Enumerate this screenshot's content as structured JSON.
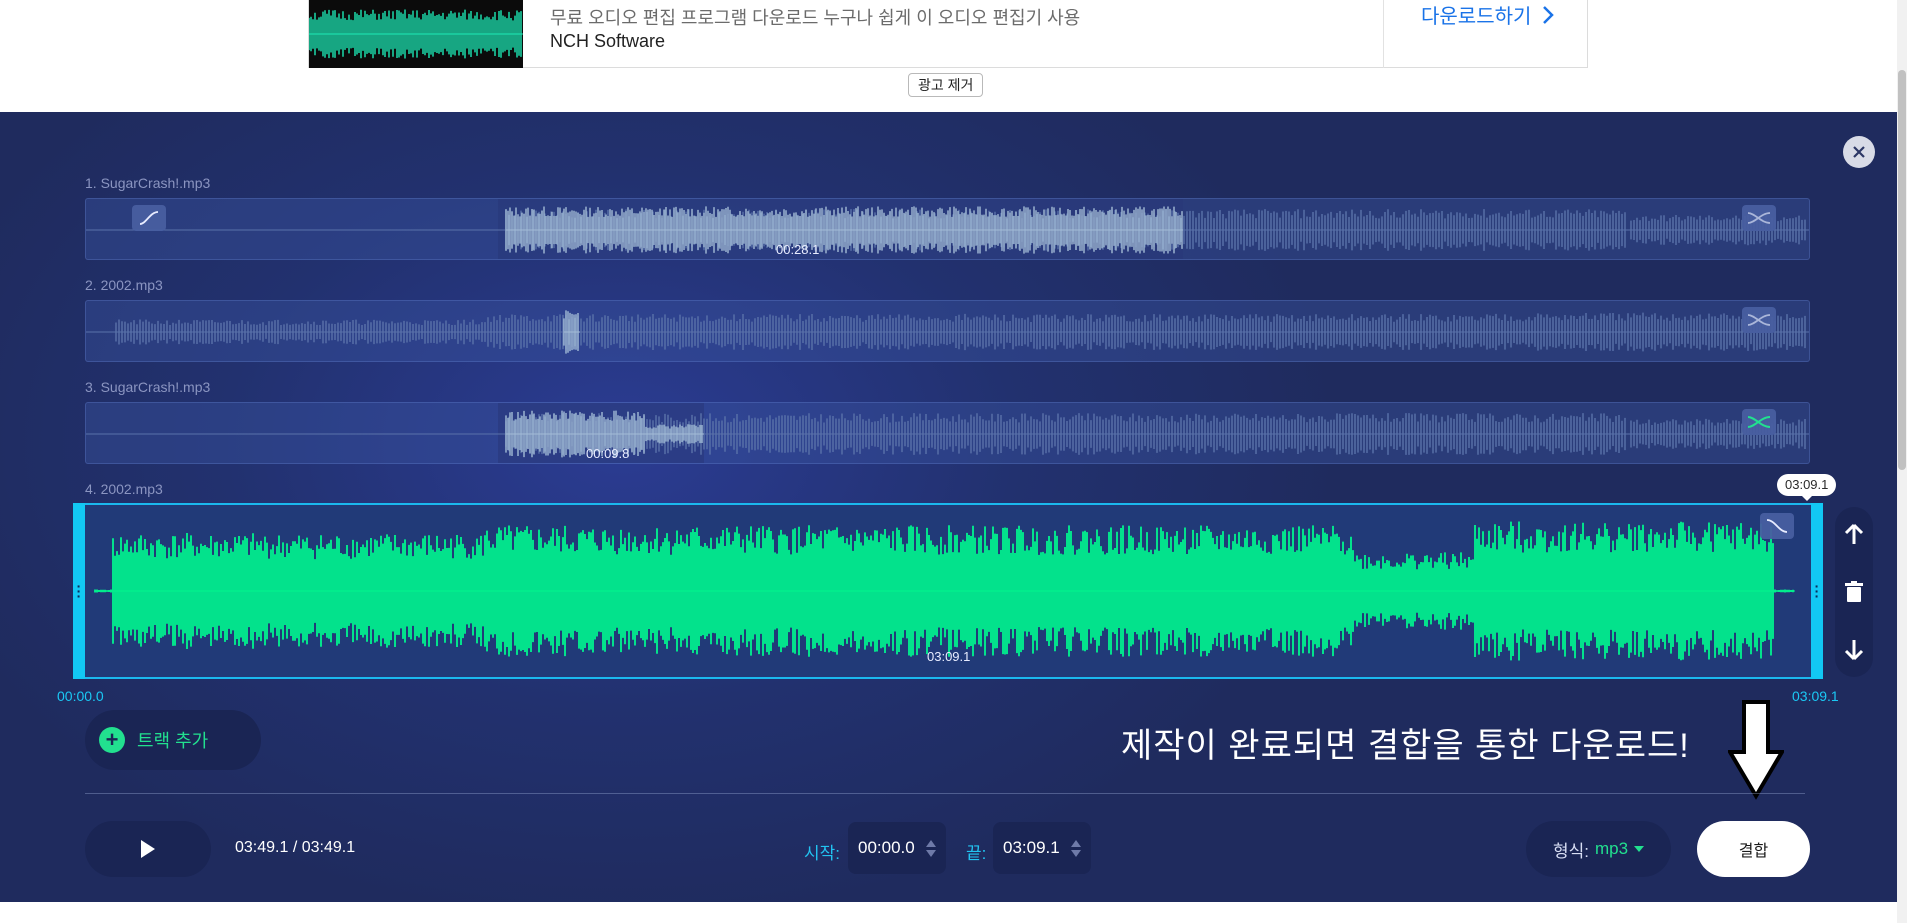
{
  "ad": {
    "description": "무료 오디오 편집 프로그램 다운로드 누구나 쉽게 이 오디오 편집기 사용",
    "brand": "NCH Software",
    "cta_label": "다운로드하기",
    "remove_label": "광고 제거"
  },
  "tracks": [
    {
      "label": "1. SugarCrash!.mp3",
      "selection_time": "00:28.1",
      "fade_icon": "fade-in-icon",
      "shuffle_icon": "crossfade-icon"
    },
    {
      "label": "2. 2002.mp3",
      "fade_icon": "",
      "shuffle_icon": "crossfade-icon"
    },
    {
      "label": "3. SugarCrash!.mp3",
      "selection_time": "00:09.8",
      "shuffle_icon": "crossfade-icon-active"
    },
    {
      "label": "4. 2002.mp3",
      "selection_time": "03:09.1",
      "tooltip": "03:09.1",
      "fade_icon": "fade-out-icon"
    }
  ],
  "range": {
    "start": "00:00.0",
    "end": "03:09.1"
  },
  "side_controls": [
    "move-up-icon",
    "trash-icon",
    "move-down-icon"
  ],
  "add_track_label": "트랙 추가",
  "annotation": "제작이 완료되면 결합을 통한 다운로드!",
  "player": {
    "time_display": "03:49.1 / 03:49.1"
  },
  "trim": {
    "start_label": "시작:",
    "start_value": "00:00.0",
    "end_label": "끝:",
    "end_value": "03:09.1"
  },
  "format": {
    "label": "형식:",
    "value": "mp3"
  },
  "combine_label": "결합",
  "colors": {
    "accent_green": "#22e08f",
    "accent_cyan": "#1bc8f4",
    "wave_active": "#00f58e",
    "wave_selected": "#a3bcd6",
    "wave_dim": "#5a72aa"
  }
}
